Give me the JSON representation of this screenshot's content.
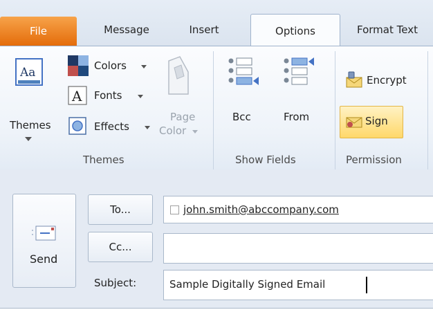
{
  "tabs": {
    "file": "File",
    "message": "Message",
    "insert": "Insert",
    "options": "Options",
    "format_text": "Format Text"
  },
  "ribbon": {
    "themes": {
      "themes_label": "Themes",
      "colors_label": "Colors",
      "fonts_label": "Fonts",
      "effects_label": "Effects",
      "page_color_line1": "Page",
      "page_color_line2": "Color",
      "group_label": "Themes"
    },
    "show_fields": {
      "bcc_label": "Bcc",
      "from_label": "From",
      "group_label": "Show Fields"
    },
    "permission": {
      "encrypt_label": "Encrypt",
      "sign_label": "Sign",
      "group_label": "Permission"
    }
  },
  "compose": {
    "send_label": "Send",
    "to_button": "To...",
    "cc_button": "Cc...",
    "subject_label": "Subject:",
    "to_value": "john.smith@abccompany.com",
    "cc_value": "",
    "subject_value": "Sample Digitally Signed Email"
  },
  "colors": {
    "file_tab": "#e46c0a",
    "sign_highlight": "#ffd86a",
    "ribbon_bg": "#fbfcfe"
  }
}
